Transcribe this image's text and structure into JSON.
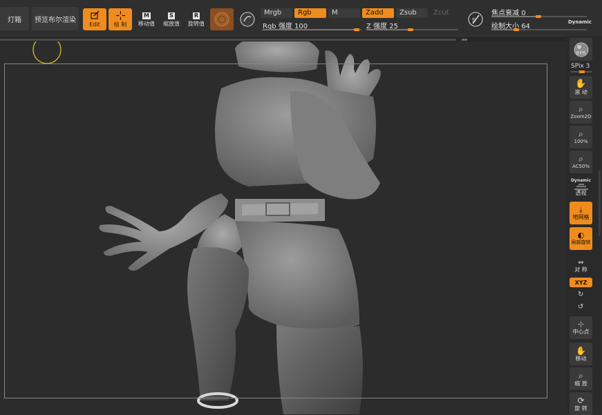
{
  "toolbar": {
    "lightbox_label": "灯箱",
    "bpr_preview_label": "预览布尔渲染",
    "edit_label": "Edit",
    "draw_label": "绘 制",
    "move_label": "移动值",
    "scale_label": "缩放值",
    "rotate_label": "旋转值",
    "move_key": "M",
    "scale_key": "S",
    "rotate_key": "R",
    "mrgb": "Mrgb",
    "rgb": "Rgb",
    "m": "M",
    "zadd": "Zadd",
    "zsub": "Zsub",
    "zcut": "Zcut",
    "rgb_intensity_label": "Rgb 强度",
    "rgb_intensity_value": "100",
    "z_intensity_label": "Z 强度",
    "z_intensity_value": "25",
    "focal_shift_label": "焦点衰减",
    "focal_shift_value": "0",
    "draw_size_label": "绘制大小",
    "draw_size_value": "64",
    "dynamic_label": "Dynamic"
  },
  "right_shelf": {
    "bpr": "BPR",
    "spix_label": "SPix",
    "spix_value": "3",
    "scroll": "滚 动",
    "zoom2d": "Zoom2D",
    "zoom100": "100%",
    "ac50": "AC50%",
    "dynamic": "Dynamic",
    "perspective": "透视",
    "floor": "地网格",
    "local": "局部旋转",
    "symmetry": "对 称",
    "xyz": "XYZ",
    "center": "中心点",
    "move": "移动",
    "scale": "缩 放",
    "rotate": "旋 转"
  },
  "colors": {
    "accent": "#f08c1e",
    "panel": "#2f2f2f",
    "canvas": "#2c2c2c",
    "button": "#3a3a3a"
  }
}
